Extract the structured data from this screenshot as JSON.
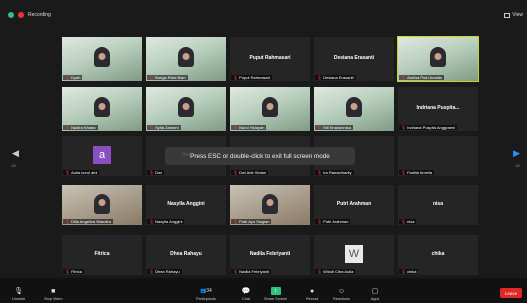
{
  "topbar": {
    "recording_label": "Recording",
    "view_label": "View"
  },
  "tiles": [
    {
      "label": "Dyah",
      "kind": "video"
    },
    {
      "label": "Bunga Rizki Bairi",
      "kind": "video"
    },
    {
      "label": "Puput Rahmasari",
      "center_name": "Puput Rahmasari",
      "kind": "name"
    },
    {
      "label": "Desiana Erasanti",
      "center_name": "Desiana Erasanti",
      "kind": "name"
    },
    {
      "label": "Annisa Putri Amalia",
      "kind": "video",
      "active": true
    },
    {
      "label": "Nadira Khaira",
      "kind": "video"
    },
    {
      "label": "Syifa Zahrani",
      "kind": "video"
    },
    {
      "label": "Nurul Hidayah",
      "kind": "video"
    },
    {
      "label": "Siti Khairunnisa",
      "kind": "video"
    },
    {
      "label": "Indriana Puspita Anggraeni",
      "center_name": "Indriana Puspita...",
      "kind": "name"
    },
    {
      "label": "Aulia nurul aini",
      "kind": "avatar",
      "avatar": "a"
    },
    {
      "label": "Dwi",
      "center_name": "Dwi",
      "kind": "name"
    },
    {
      "label": "Dwi Ade Wulan",
      "kind": "name",
      "center_name": ""
    },
    {
      "label": "Ira Ramadhanty",
      "kind": "name",
      "center_name": ""
    },
    {
      "label": "Fadilla Amelia",
      "kind": "name",
      "center_name": ""
    },
    {
      "label": "Dilla Angelica Wandira",
      "kind": "photo"
    },
    {
      "label": "Nasylla Anggini",
      "center_name": "Nasylla Anggini",
      "kind": "name"
    },
    {
      "label": "Putri Ayu Siagian",
      "kind": "photo"
    },
    {
      "label": "Putri Arahman",
      "center_name": "Putri Arahman",
      "kind": "name"
    },
    {
      "label": "nisa",
      "center_name": "nisa",
      "kind": "name"
    },
    {
      "label": "Fitrica",
      "center_name": "Fitrica",
      "kind": "name"
    },
    {
      "label": "Dhea Rahayu",
      "center_name": "Dhea Rahayu",
      "kind": "name"
    },
    {
      "label": "Nadila Febriyanti",
      "center_name": "Nadila Febriyanti",
      "kind": "name"
    },
    {
      "label": "Wilodi Citra Aulia",
      "kind": "avatar",
      "avatar": "W"
    },
    {
      "label": "chika",
      "center_name": "chika",
      "kind": "name"
    }
  ],
  "toast": "Press ESC or double-click to exit full screen mode",
  "pager": {
    "left": "1/2",
    "right": "1/2"
  },
  "toolbar": {
    "unmute": "Unmute",
    "stop_video": "Stop Video",
    "participants": "Participants",
    "participants_count": "34",
    "chat": "Chat",
    "share_screen": "Share Screen",
    "record": "Record",
    "reactions": "Reactions",
    "apps": "Apps",
    "leave": "Leave"
  }
}
